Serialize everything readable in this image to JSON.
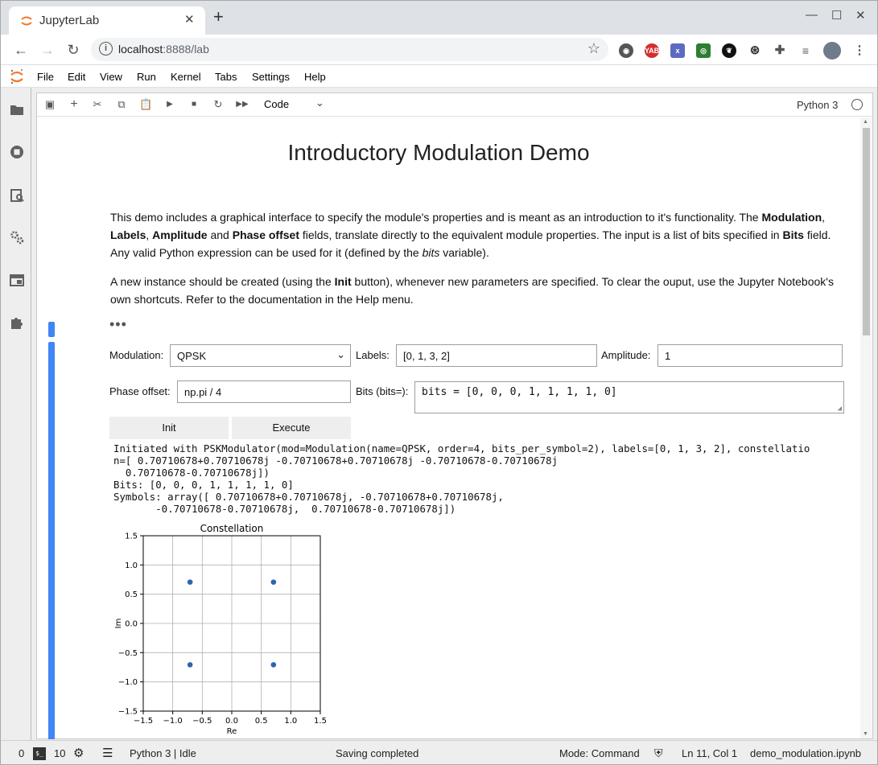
{
  "browser": {
    "tab_title": "JupyterLab",
    "url_host": "localhost",
    "url_path": ":8888/lab",
    "extensions": [
      "lightbulb-ext",
      "yab-ext",
      "x-ext",
      "green-ext",
      "gnome-ext",
      "steering-ext",
      "puzzle-ext",
      "playlist-ext",
      "avatar"
    ]
  },
  "menubar": {
    "items": [
      "File",
      "Edit",
      "View",
      "Run",
      "Kernel",
      "Tabs",
      "Settings",
      "Help"
    ]
  },
  "notebook_toolbar": {
    "cell_type": "Code",
    "kernel": "Python 3"
  },
  "content": {
    "heading": "Introductory Modulation Demo",
    "para1_a": "This demo includes a graphical interface to specify the module's properties and is meant as an introduction to it's functionality. The ",
    "para1_b": "Modulation",
    "para1_c": ", ",
    "para1_d": "Labels",
    "para1_e": ", ",
    "para1_f": "Amplitude",
    "para1_g": " and ",
    "para1_h": "Phase offset",
    "para1_i": " fields, translate directly to the equivalent module properties. The input is a list of bits specified in ",
    "para1_j": "Bits",
    "para1_k": " field. Any valid Python expression can be used for it (defined by the ",
    "para1_l": "bits",
    "para1_m": " variable).",
    "para2_a": "A new instance should be created (using the ",
    "para2_b": "Init",
    "para2_c": " button), whenever new parameters are specified. To clear the ouput, use the Jupyter Notebook's own shortcuts. Refer to the documentation in the Help menu.",
    "ellipsis": "•••"
  },
  "widgets": {
    "modulation_label": "Modulation:",
    "modulation_value": "QPSK",
    "labels_label": "Labels:",
    "labels_value": "[0, 1, 3, 2]",
    "amplitude_label": "Amplitude:",
    "amplitude_value": "1",
    "phase_label": "Phase offset:",
    "phase_value": "np.pi / 4",
    "bits_label": "Bits (bits=):",
    "bits_value": "bits = [0, 0, 0, 1, 1, 1, 1, 0]",
    "init_button": "Init",
    "execute_button": "Execute"
  },
  "output": {
    "text": "Initiated with PSKModulator(mod=Modulation(name=QPSK, order=4, bits_per_symbol=2), labels=[0, 1, 3, 2], constellatio\nn=[ 0.70710678+0.70710678j -0.70710678+0.70710678j -0.70710678-0.70710678j\n  0.70710678-0.70710678j])\nBits: [0, 0, 0, 1, 1, 1, 1, 0]\nSymbols: array([ 0.70710678+0.70710678j, -0.70710678+0.70710678j,\n       -0.70710678-0.70710678j,  0.70710678-0.70710678j])"
  },
  "chart_data": {
    "type": "scatter",
    "title": "Constellation",
    "xlabel": "Re",
    "ylabel": "Im",
    "xlim": [
      -1.5,
      1.5
    ],
    "ylim": [
      -1.5,
      1.5
    ],
    "xticks": [
      "−1.5",
      "−1.0",
      "−0.5",
      "0.0",
      "0.5",
      "1.0",
      "1.5"
    ],
    "yticks": [
      "1.5",
      "1.0",
      "0.5",
      "0.0",
      "−0.5",
      "−1.0",
      "−1.5"
    ],
    "xtick_values": [
      -1.5,
      -1.0,
      -0.5,
      0.0,
      0.5,
      1.0,
      1.5
    ],
    "ytick_values": [
      1.5,
      1.0,
      0.5,
      0.0,
      -0.5,
      -1.0,
      -1.5
    ],
    "grid": true,
    "points": [
      {
        "x": -0.7071,
        "y": 0.7071
      },
      {
        "x": 0.7071,
        "y": 0.7071
      },
      {
        "x": -0.7071,
        "y": -0.7071
      },
      {
        "x": 0.7071,
        "y": -0.7071
      }
    ],
    "color": "#2c64b0"
  },
  "statusbar": {
    "terminals": "0",
    "kernels": "10",
    "kernel_status": "Python 3 | Idle",
    "save_status": "Saving completed",
    "mode": "Mode: Command",
    "cursor": "Ln 11, Col 1",
    "filename": "demo_modulation.ipynb"
  }
}
